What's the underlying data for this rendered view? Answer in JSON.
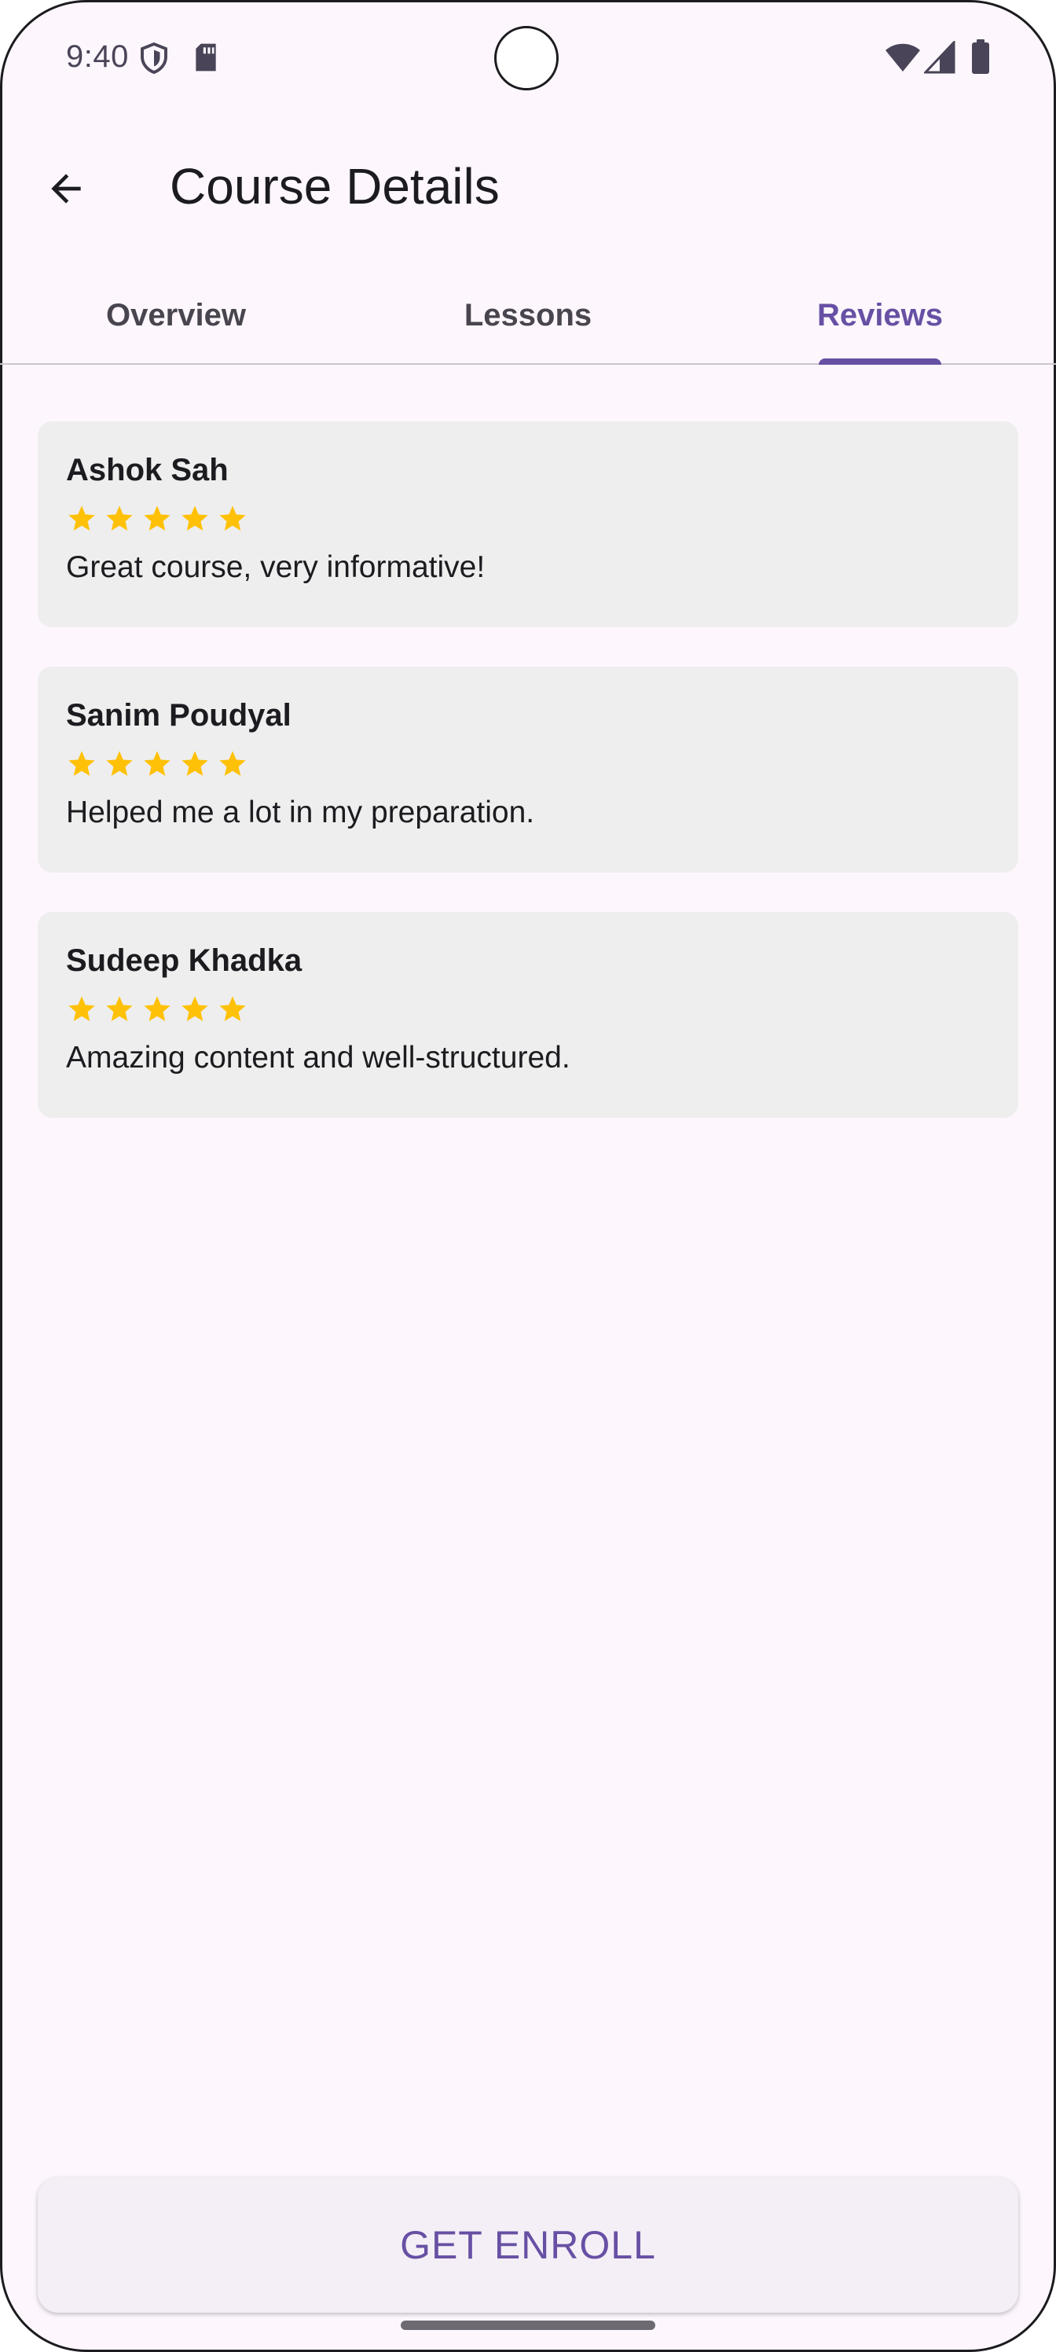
{
  "status_bar": {
    "time": "9:40",
    "icons": [
      "shield-icon",
      "sd-card-icon",
      "wifi-icon",
      "signal-icon",
      "battery-icon"
    ]
  },
  "app_bar": {
    "title": "Course Details",
    "back_icon": "arrow-back-icon"
  },
  "tabs": [
    {
      "label": "Overview",
      "active": false
    },
    {
      "label": "Lessons",
      "active": false
    },
    {
      "label": "Reviews",
      "active": true
    }
  ],
  "reviews": [
    {
      "name": "Ashok Sah",
      "rating": 5,
      "text": "Great course, very informative!"
    },
    {
      "name": "Sanim Poudyal",
      "rating": 5,
      "text": "Helped me a lot in my preparation."
    },
    {
      "name": "Sudeep Khadka",
      "rating": 5,
      "text": "Amazing content and well-structured."
    }
  ],
  "enroll_button": {
    "label": "GET ENROLL"
  },
  "colors": {
    "accent": "#6750a4",
    "star": "#ffc107",
    "card_bg": "#eeeeee",
    "page_bg": "#fdf7fd"
  }
}
